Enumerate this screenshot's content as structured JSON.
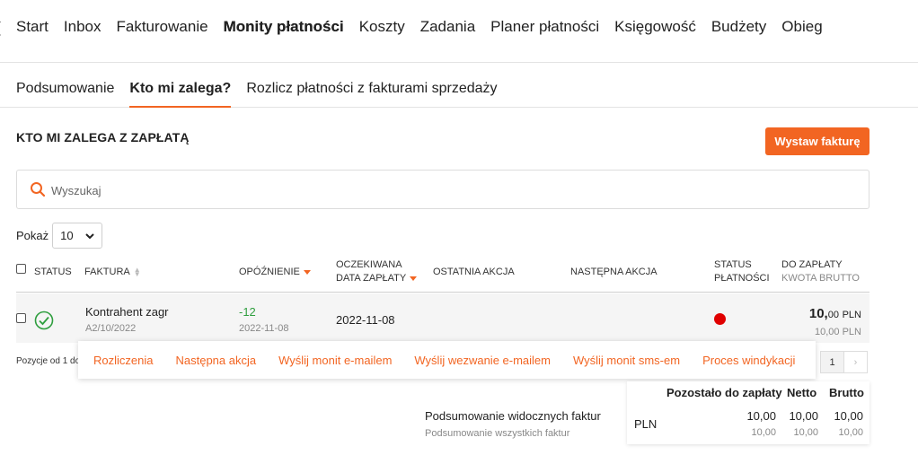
{
  "topnav": {
    "edge": "[",
    "items": [
      "Start",
      "Inbox",
      "Fakturowanie",
      "Monity płatności",
      "Koszty",
      "Zadania",
      "Planer płatności",
      "Księgowość",
      "Budżety",
      "Obieg"
    ],
    "active": "Monity płatności"
  },
  "subnav": {
    "items": [
      "Podsumowanie",
      "Kto mi zalega?",
      "Rozlicz płatności z fakturami sprzedaży"
    ],
    "active": "Kto mi zalega?"
  },
  "page": {
    "title": "KTO MI ZALEGA Z ZAPŁATĄ",
    "issue_invoice_button": "Wystaw fakturę"
  },
  "search": {
    "placeholder": "Wyszukaj",
    "value": ""
  },
  "show": {
    "label": "Pokaż",
    "selected": "10"
  },
  "table": {
    "headers": {
      "status": "STATUS",
      "invoice": "FAKTURA",
      "delay": "OPÓŹNIENIE",
      "expected_date_line1": "OCZEKIWANA",
      "expected_date_line2": "DATA ZAPŁATY",
      "last_action": "OSTATNIA AKCJA",
      "next_action": "NASTĘPNA AKCJA",
      "payment_status_line1": "STATUS",
      "payment_status_line2": "PŁATNOŚCI",
      "to_pay_line1": "DO ZAPŁATY",
      "to_pay_line2": "KWOTA BRUTTO"
    },
    "rows": [
      {
        "status_icon": "check-circle-icon",
        "contractor": "Kontrahent zagr",
        "invoice_number": "A2/10/2022",
        "delay_days": "-12",
        "delay_date": "2022-11-08",
        "expected_date": "2022-11-08",
        "last_action": "",
        "next_action": "",
        "payment_status_color": "#e00000",
        "amount_int": "10,",
        "amount_dec": "00",
        "currency": "PLN",
        "gross_amount": "10,00 PLN"
      }
    ]
  },
  "footer": {
    "positions_text": "Pozycje od 1 do",
    "current_page": "1",
    "next_symbol": "›"
  },
  "actions": [
    "Rozliczenia",
    "Następna akcja",
    "Wyślij monit e-mailem",
    "Wyślij wezwanie e-mailem",
    "Wyślij monit sms-em",
    "Proces windykacji"
  ],
  "summary": {
    "visible_label": "Podsumowanie widocznych faktur",
    "all_label": "Podsumowanie wszystkich faktur",
    "headers": [
      "Pozostało do zapłaty",
      "Netto",
      "Brutto"
    ],
    "currency": "PLN",
    "visible": [
      "10,00",
      "10,00",
      "10,00"
    ],
    "all": [
      "10,00",
      "10,00",
      "10,00"
    ]
  },
  "colors": {
    "accent": "#f26522",
    "success": "#2e9e3e",
    "danger": "#e00000"
  }
}
